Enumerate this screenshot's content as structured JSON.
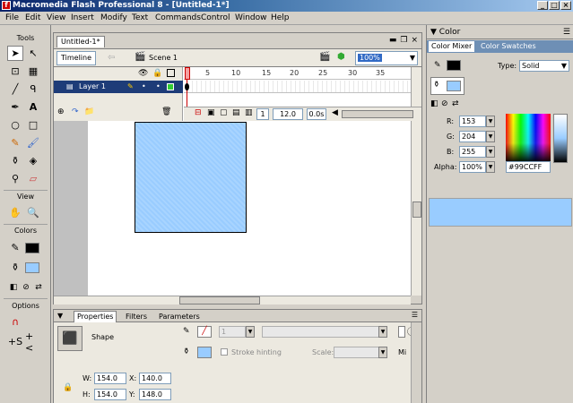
{
  "window": {
    "title": "Macromedia Flash Professional 8 - [Untitled-1*]"
  },
  "menu": [
    "File",
    "Edit",
    "View",
    "Insert",
    "Modify",
    "Text",
    "Commands",
    "Control",
    "Window",
    "Help"
  ],
  "tools": {
    "tools_label": "Tools",
    "view_label": "View",
    "colors_label": "Colors",
    "options_label": "Options"
  },
  "document": {
    "tab": "Untitled-1*",
    "timeline_button": "Timeline",
    "scene": "Scene 1",
    "zoom": "100%",
    "layer_name": "Layer 1",
    "frame_numbers": [
      "5",
      "10",
      "15",
      "20",
      "25",
      "30",
      "35"
    ],
    "current_frame": "1",
    "fps": "12.0 fps",
    "elapsed": "0.0s"
  },
  "properties": {
    "tabs": [
      "Properties",
      "Filters",
      "Parameters"
    ],
    "selection_type": "Shape",
    "stroke_height": "1",
    "stroke_hinting_label": "Stroke hinting",
    "scale_label": "Scale:",
    "miter_label": "Mi",
    "w_label": "W:",
    "w_value": "154.0",
    "h_label": "H:",
    "h_value": "154.0",
    "x_label": "X:",
    "x_value": "140.0",
    "y_label": "Y:",
    "y_value": "148.0"
  },
  "color_panel": {
    "title": "Color",
    "tabs": [
      "Color Mixer",
      "Color Swatches"
    ],
    "type_label": "Type:",
    "type_value": "Solid",
    "r_label": "R:",
    "r_value": "153",
    "g_label": "G:",
    "g_value": "204",
    "b_label": "B:",
    "b_value": "255",
    "alpha_label": "Alpha:",
    "alpha_value": "100%",
    "hex_value": "#99CCFF"
  },
  "colors": {
    "fill": "#99CCFF",
    "stroke": "#000000"
  }
}
